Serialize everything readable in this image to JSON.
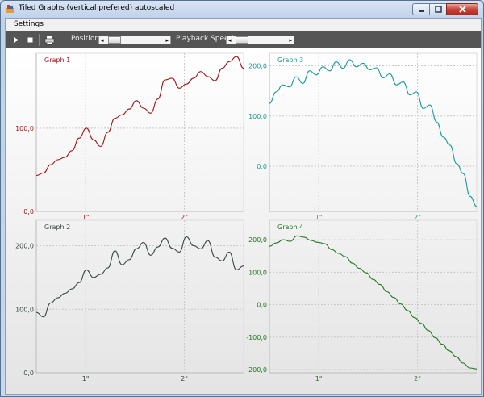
{
  "window": {
    "title": "Tiled Graphs (vertical prefered) autoscaled"
  },
  "menu": {
    "settings": "Settings"
  },
  "toolbar": {
    "position_label": "Position",
    "speed_label": "Playback Speed"
  },
  "colors": {
    "graph1": "#a01818",
    "graph2": "#3c4a48",
    "graph3": "#1a9a9a",
    "graph4": "#1e7a1e",
    "grid": "#c8c8c8"
  },
  "chart_data": [
    {
      "type": "line",
      "title": "Graph 1",
      "x": [
        0,
        2.1
      ],
      "xticks": [
        "1\"",
        "2\""
      ],
      "xtick_values": [
        0.5,
        1.5
      ],
      "yticks": [
        "0,0",
        "100,0"
      ],
      "ytick_values": [
        0,
        100
      ],
      "ylim": [
        0,
        190
      ],
      "grid": true,
      "series": [
        {
          "values": [
            43,
            46,
            56,
            62,
            65,
            73,
            88,
            100,
            86,
            78,
            95,
            112,
            116,
            123,
            133,
            124,
            118,
            135,
            158,
            160,
            148,
            153,
            160,
            168,
            162,
            157,
            172,
            180,
            186,
            172
          ]
        }
      ]
    },
    {
      "type": "line",
      "title": "Graph 2",
      "x": [
        0,
        2.1
      ],
      "xticks": [
        "1\"",
        "2\""
      ],
      "xtick_values": [
        0.5,
        1.5
      ],
      "yticks": [
        "0,0",
        "100,0",
        "200,0"
      ],
      "ytick_values": [
        0,
        100,
        200
      ],
      "ylim": [
        0,
        240
      ],
      "grid": true,
      "series": [
        {
          "values": [
            95,
            88,
            110,
            118,
            125,
            132,
            142,
            162,
            150,
            155,
            165,
            192,
            170,
            178,
            195,
            205,
            185,
            198,
            212,
            196,
            190,
            214,
            200,
            195,
            208,
            182,
            176,
            190,
            162,
            168
          ]
        }
      ]
    },
    {
      "type": "line",
      "title": "Graph 3",
      "x": [
        0,
        2.1
      ],
      "xticks": [
        "1\"",
        "2\""
      ],
      "xtick_values": [
        0.5,
        1.5
      ],
      "yticks": [
        "0,0",
        "100,0",
        "200,0"
      ],
      "ytick_values": [
        0,
        100,
        200
      ],
      "ylim": [
        -90,
        225
      ],
      "grid": true,
      "series": [
        {
          "values": [
            125,
            148,
            162,
            158,
            178,
            165,
            190,
            182,
            198,
            190,
            208,
            195,
            212,
            198,
            205,
            192,
            196,
            176,
            184,
            162,
            168,
            142,
            148,
            115,
            122,
            88,
            58,
            42,
            5,
            -15,
            -60,
            -80
          ]
        }
      ]
    },
    {
      "type": "line",
      "title": "Graph 4",
      "x": [
        0,
        2.1
      ],
      "xticks": [
        "1\"",
        "2\""
      ],
      "xtick_values": [
        0.5,
        1.5
      ],
      "yticks": [
        "-200,0",
        "-100,0",
        "0,0",
        "100,0",
        "200,0"
      ],
      "ytick_values": [
        -200,
        -100,
        0,
        100,
        200
      ],
      "ylim": [
        -210,
        260
      ],
      "grid": true,
      "series": [
        {
          "values": [
            180,
            190,
            200,
            195,
            212,
            208,
            198,
            192,
            188,
            170,
            158,
            148,
            128,
            112,
            98,
            78,
            62,
            40,
            22,
            2,
            -18,
            -40,
            -58,
            -80,
            -102,
            -122,
            -142,
            -160,
            -180,
            -195,
            -198
          ]
        }
      ]
    }
  ]
}
